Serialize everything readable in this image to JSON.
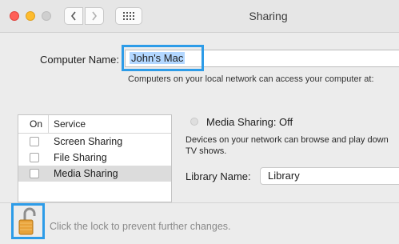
{
  "window": {
    "title": "Sharing"
  },
  "computer_name": {
    "label": "Computer Name:",
    "value": "John's Mac",
    "hint": "Computers on your local network can access your computer at:"
  },
  "services": {
    "header_on": "On",
    "header_service": "Service",
    "items": [
      {
        "label": "Screen Sharing",
        "checked": false
      },
      {
        "label": "File Sharing",
        "checked": false
      },
      {
        "label": "Media Sharing",
        "checked": false
      }
    ]
  },
  "detail": {
    "status": "Media Sharing: Off",
    "description_line1": "Devices on your network can browse and play down",
    "description_line2": "TV shows.",
    "library_label": "Library Name:",
    "library_value": "Library"
  },
  "footer": {
    "lock_text": "Click the lock to prevent further changes."
  }
}
